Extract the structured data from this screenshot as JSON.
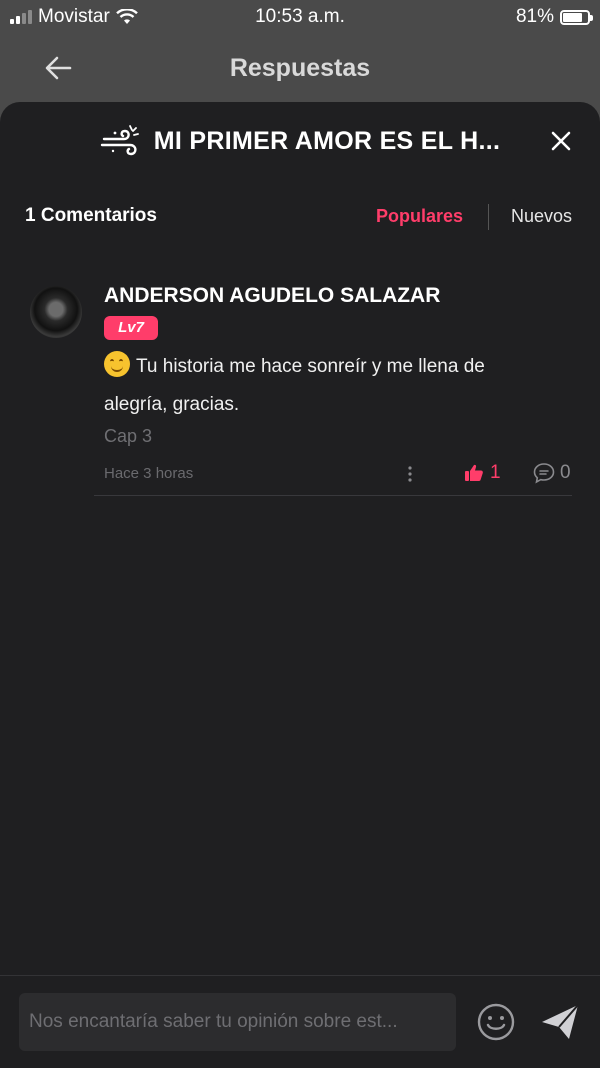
{
  "status_bar": {
    "carrier": "Movistar",
    "time": "10:53 a.m.",
    "battery": "81%",
    "battery_level": 0.81
  },
  "nav": {
    "title": "Respuestas",
    "back_icon": "arrow-left-icon"
  },
  "sheet": {
    "story_title": "MI PRIMER AMOR ES EL H...",
    "story_icon": "wind-icon",
    "close_icon": "close-icon"
  },
  "comments": {
    "count_label": "1 Comentarios",
    "sort_options": [
      "Populares",
      "Nuevos"
    ],
    "active_sort": "Populares",
    "items": [
      {
        "author": "ANDERSON AGUDELO SALAZAR",
        "level": "Lv7",
        "text": "Tu historia me hace sonreír y me llena de alegría, gracias.",
        "emoji": "smiling-face-icon",
        "chapter": "Cap 3",
        "timestamp": "Hace 3 horas",
        "likes": "1",
        "replies": "0"
      }
    ]
  },
  "input": {
    "placeholder": "Nos encantaría saber tu opinión sobre est..."
  },
  "colors": {
    "accent": "#ff3d6a",
    "sheet_bg": "#1f1f21",
    "header_bg": "#4a4a4a"
  }
}
